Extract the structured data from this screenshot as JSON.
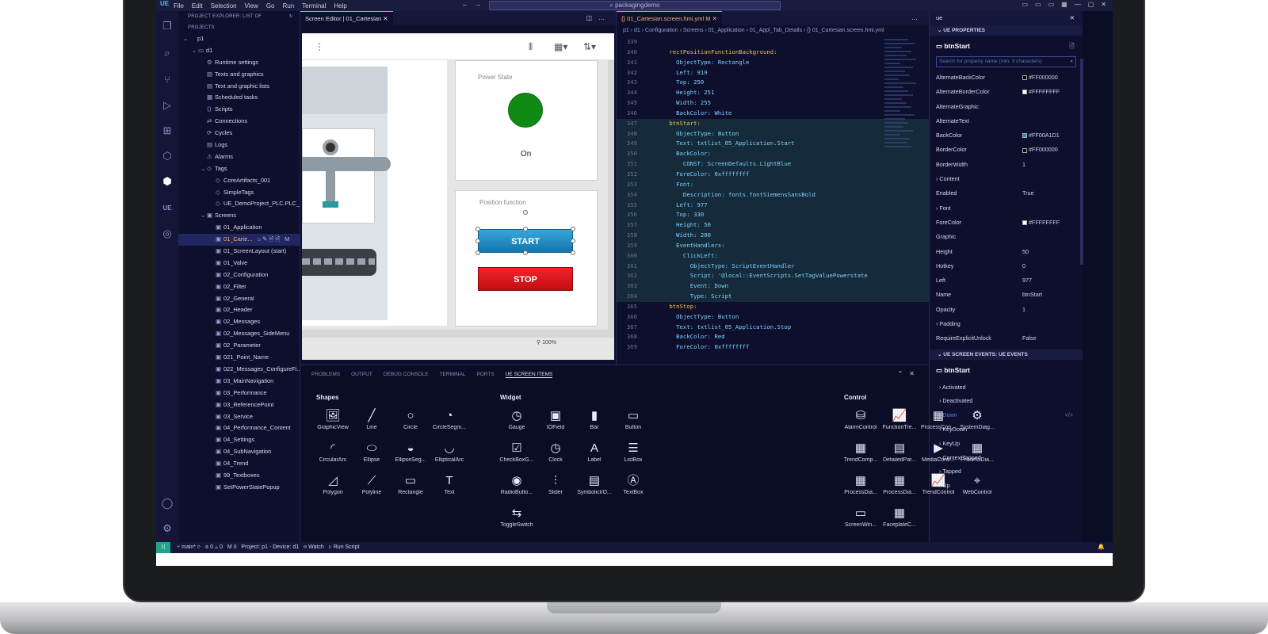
{
  "titlebar": {
    "logo": "UE",
    "menu": [
      "File",
      "Edit",
      "Selection",
      "View",
      "Go",
      "Run",
      "Terminal",
      "Help"
    ],
    "search": "packagingdemo"
  },
  "explorer": {
    "header": "PROJECT EXPLORER: LIST OF PROJECTS",
    "items": [
      {
        "label": "p1",
        "depth": 0,
        "tw": "⌄",
        "icon": ""
      },
      {
        "label": "d1",
        "depth": 1,
        "tw": "⌄",
        "icon": "▭"
      },
      {
        "label": "Runtime settings",
        "depth": 2,
        "tw": "",
        "icon": "⚙"
      },
      {
        "label": "Texts and graphics",
        "depth": 2,
        "tw": "",
        "icon": "▤"
      },
      {
        "label": "Text and graphic lists",
        "depth": 2,
        "tw": "",
        "icon": "▤"
      },
      {
        "label": "Scheduled tasks",
        "depth": 2,
        "tw": "",
        "icon": "▦"
      },
      {
        "label": "Scripts",
        "depth": 2,
        "tw": "",
        "icon": "⟨⟩"
      },
      {
        "label": "Connections",
        "depth": 2,
        "tw": "",
        "icon": "⇄"
      },
      {
        "label": "Cycles",
        "depth": 2,
        "tw": "",
        "icon": "⟳"
      },
      {
        "label": "Logs",
        "depth": 2,
        "tw": "",
        "icon": "▤"
      },
      {
        "label": "Alarms",
        "depth": 2,
        "tw": "",
        "icon": "⚠"
      },
      {
        "label": "Tags",
        "depth": 2,
        "tw": "⌄",
        "icon": "◇"
      },
      {
        "label": "CoreArtifacts_001",
        "depth": 3,
        "tw": "",
        "icon": "◇"
      },
      {
        "label": "SimpleTags",
        "depth": 3,
        "tw": "",
        "icon": "◇"
      },
      {
        "label": "UE_DemoProject_PLC.PLC_...",
        "depth": 3,
        "tw": "",
        "icon": "◇"
      },
      {
        "label": "Screens",
        "depth": 2,
        "tw": "⌄",
        "icon": "▣"
      },
      {
        "label": "01_Application",
        "depth": 3,
        "tw": "",
        "icon": "▣"
      },
      {
        "label": "01_Carte...",
        "depth": 3,
        "tw": "",
        "icon": "▣",
        "selected": true,
        "actions": "⌂✎🗎🗎 M"
      },
      {
        "label": "01_ScreenLayout (start)",
        "depth": 3,
        "tw": "",
        "icon": "▣"
      },
      {
        "label": "01_Valve",
        "depth": 3,
        "tw": "",
        "icon": "▣"
      },
      {
        "label": "02_Configuration",
        "depth": 3,
        "tw": "",
        "icon": "▣"
      },
      {
        "label": "02_Filter",
        "depth": 3,
        "tw": "",
        "icon": "▣"
      },
      {
        "label": "02_General",
        "depth": 3,
        "tw": "",
        "icon": "▣"
      },
      {
        "label": "02_Header",
        "depth": 3,
        "tw": "",
        "icon": "▣"
      },
      {
        "label": "02_Messages",
        "depth": 3,
        "tw": "",
        "icon": "▣"
      },
      {
        "label": "02_Messages_SideMenu",
        "depth": 3,
        "tw": "",
        "icon": "▣"
      },
      {
        "label": "02_Parameter",
        "depth": 3,
        "tw": "",
        "icon": "▣"
      },
      {
        "label": "021_Point_Name",
        "depth": 3,
        "tw": "",
        "icon": "▣"
      },
      {
        "label": "022_Messages_ConfigureFi...",
        "depth": 3,
        "tw": "",
        "icon": "▣"
      },
      {
        "label": "03_MainNavigation",
        "depth": 3,
        "tw": "",
        "icon": "▣"
      },
      {
        "label": "03_Performance",
        "depth": 3,
        "tw": "",
        "icon": "▣"
      },
      {
        "label": "03_ReferencePoint",
        "depth": 3,
        "tw": "",
        "icon": "▣"
      },
      {
        "label": "03_Service",
        "depth": 3,
        "tw": "",
        "icon": "▣"
      },
      {
        "label": "04_Performance_Content",
        "depth": 3,
        "tw": "",
        "icon": "▣"
      },
      {
        "label": "04_Settings",
        "depth": 3,
        "tw": "",
        "icon": "▣"
      },
      {
        "label": "04_SubNavigation",
        "depth": 3,
        "tw": "",
        "icon": "▣"
      },
      {
        "label": "04_Trend",
        "depth": 3,
        "tw": "",
        "icon": "▣"
      },
      {
        "label": "99_Textboxes",
        "depth": 3,
        "tw": "",
        "icon": "▣"
      },
      {
        "label": "SetPowerStatePopup",
        "depth": 3,
        "tw": "",
        "icon": "▣"
      }
    ]
  },
  "editor1": {
    "tab": "Screen Editor | 01_Cartesian",
    "panel1_title": "Power State",
    "power_on": "On",
    "panel2_title": "Position function",
    "start": "START",
    "stop": "STOP",
    "zoom": "100%"
  },
  "editor2": {
    "tab": "01_Cartesian.screen.hmi.yml M",
    "breadcrumb": "p1 › d1 › Configuration › Screens › 01_Application › 01_Appl_Tab_Details › {} 01_Cartesian.screen.hmi.yml",
    "lines": [
      {
        "n": "339",
        "t": "",
        "c": ""
      },
      {
        "n": "340",
        "t": "      rectPositionFunctionBackground:",
        "c": "k"
      },
      {
        "n": "341",
        "t": "        ObjectType: Rectangle",
        "c": ""
      },
      {
        "n": "342",
        "t": "        Left: 919",
        "c": ""
      },
      {
        "n": "343",
        "t": "        Top: 250",
        "c": ""
      },
      {
        "n": "344",
        "t": "        Height: 251",
        "c": ""
      },
      {
        "n": "345",
        "t": "        Width: 255",
        "c": ""
      },
      {
        "n": "346",
        "t": "        BackColor: White",
        "c": ""
      },
      {
        "n": "347",
        "t": "      btnStart:",
        "c": "k",
        "hl": true
      },
      {
        "n": "348",
        "t": "        ObjectType: Button",
        "c": "",
        "hl": true
      },
      {
        "n": "349",
        "t": "        Text: txtlist_05_Application.Start",
        "c": "",
        "hl": true
      },
      {
        "n": "350",
        "t": "        BackColor:",
        "c": "",
        "hl": true
      },
      {
        "n": "351",
        "t": "          CONST: ScreenDefaults.LightBlue",
        "c": "",
        "hl": true
      },
      {
        "n": "352",
        "t": "        ForeColor: 0xffffffff",
        "c": "",
        "hl": true
      },
      {
        "n": "353",
        "t": "        Font:",
        "c": "",
        "hl": true
      },
      {
        "n": "354",
        "t": "          Description: fonts.fontSiemensSansBold",
        "c": "",
        "hl": true
      },
      {
        "n": "355",
        "t": "        Left: 977",
        "c": "",
        "hl": true
      },
      {
        "n": "356",
        "t": "        Top: 330",
        "c": "",
        "hl": true
      },
      {
        "n": "357",
        "t": "        Height: 50",
        "c": "",
        "hl": true
      },
      {
        "n": "358",
        "t": "        Width: 200",
        "c": "",
        "hl": true
      },
      {
        "n": "359",
        "t": "        EventHandlers:",
        "c": "",
        "hl": true
      },
      {
        "n": "360",
        "t": "          ClickLeft:",
        "c": "",
        "hl": true
      },
      {
        "n": "361",
        "t": "            ObjectType: ScriptEventHandler",
        "c": "",
        "hl": true
      },
      {
        "n": "362",
        "t": "            Script: '@local::EventScripts.SetTagValuePowerstate",
        "c": "",
        "hl": true
      },
      {
        "n": "363",
        "t": "            Event: Down",
        "c": "",
        "hl": true
      },
      {
        "n": "364",
        "t": "            Type: Script",
        "c": "",
        "hl": true
      },
      {
        "n": "365",
        "t": "      btnStop:",
        "c": "k"
      },
      {
        "n": "366",
        "t": "        ObjectType: Button",
        "c": ""
      },
      {
        "n": "367",
        "t": "        Text: txtlist_05_Application.Stop",
        "c": ""
      },
      {
        "n": "368",
        "t": "        BackColor: Red",
        "c": ""
      },
      {
        "n": "369",
        "t": "        ForeColor: 0xffffffff",
        "c": ""
      }
    ]
  },
  "props": {
    "filter": "ue",
    "section": "UE PROPERTIES",
    "name": "btnStart",
    "search_placeholder": "Search for property name (min. 3 characters)",
    "rows": [
      {
        "n": "AlternateBackColor",
        "v": "#FF000000",
        "sw": "#000000"
      },
      {
        "n": "AlternateBorderColor",
        "v": "#FFFFFFFF",
        "sw": "#ffffff"
      },
      {
        "n": "AlternateGraphic",
        "v": ""
      },
      {
        "n": "AlternateText",
        "v": ""
      },
      {
        "n": "BackColor",
        "v": "#FF00A1D1",
        "sw": "#00a1d1"
      },
      {
        "n": "BorderColor",
        "v": "#FF000000",
        "sw": "#000000"
      },
      {
        "n": "BorderWidth",
        "v": "1"
      },
      {
        "n": "› Content",
        "v": ""
      },
      {
        "n": "Enabled",
        "v": "True"
      },
      {
        "n": "› Font",
        "v": ""
      },
      {
        "n": "ForeColor",
        "v": "#FFFFFFFF",
        "sw": "#ffffff"
      },
      {
        "n": "Graphic",
        "v": ""
      },
      {
        "n": "Height",
        "v": "50"
      },
      {
        "n": "Hotkey",
        "v": "0"
      },
      {
        "n": "Left",
        "v": "977"
      },
      {
        "n": "Name",
        "v": "btnStart"
      },
      {
        "n": "Opacity",
        "v": "1"
      },
      {
        "n": "› Padding",
        "v": ""
      },
      {
        "n": "RequireExplicitUnlock",
        "v": "False"
      }
    ],
    "events_section": "UE SCREEN EVENTS: UE EVENTS",
    "events_name": "btnStart",
    "events": [
      "Activated",
      "Deactivated",
      "Down",
      "KeyDown",
      "KeyUp",
      "ContextTapped",
      "Tapped",
      "Up"
    ]
  },
  "bottom": {
    "tabs": [
      "PROBLEMS",
      "OUTPUT",
      "DEBUG CONSOLE",
      "TERMINAL",
      "PORTS",
      "UE SCREEN ITEMS"
    ],
    "groups": {
      "shapes": "Shapes",
      "widget": "Widget",
      "control": "Control"
    },
    "shapes": [
      {
        "g": "🖼",
        "l": "GraphicView"
      },
      {
        "g": "╱",
        "l": "Line"
      },
      {
        "g": "○",
        "l": "Circle"
      },
      {
        "g": "◔",
        "l": "CircleSegm..."
      },
      {
        "g": "◜",
        "l": "CircularArc"
      },
      {
        "g": "⬭",
        "l": "Ellipse"
      },
      {
        "g": "◒",
        "l": "EllipseSeg..."
      },
      {
        "g": "◡",
        "l": "EllipticalArc"
      },
      {
        "g": "◿",
        "l": "Polygon"
      },
      {
        "g": "⟋",
        "l": "Polyline"
      },
      {
        "g": "▭",
        "l": "Rectangle"
      },
      {
        "g": "T",
        "l": "Text"
      }
    ],
    "widgets": [
      {
        "g": "◷",
        "l": "Gauge"
      },
      {
        "g": "▣",
        "l": "IOField"
      },
      {
        "g": "▮",
        "l": "Bar"
      },
      {
        "g": "▭",
        "l": "Button"
      },
      {
        "g": "☑",
        "l": "CheckBoxG..."
      },
      {
        "g": "◷",
        "l": "Clock"
      },
      {
        "g": "A",
        "l": "Label"
      },
      {
        "g": "☰",
        "l": "ListBox"
      },
      {
        "g": "◉",
        "l": "RadioButto..."
      },
      {
        "g": "⫶",
        "l": "Slider"
      },
      {
        "g": "▤",
        "l": "SymbolicI/O..."
      },
      {
        "g": "Ⓐ",
        "l": "TextBox"
      },
      {
        "g": "⇆",
        "l": "ToggleSwitch"
      }
    ],
    "controls": [
      {
        "g": "⛁",
        "l": "AlarmControl"
      },
      {
        "g": "📈",
        "l": "FunctionTre..."
      },
      {
        "g": "▦",
        "l": "ProcessCon..."
      },
      {
        "g": "⚙",
        "l": "SystemDiag..."
      },
      {
        "g": "▦",
        "l": "TrendComp..."
      },
      {
        "g": "▤",
        "l": "DetailedPar..."
      },
      {
        "g": "▶",
        "l": "MediaContr..."
      },
      {
        "g": "▦",
        "l": "ProcessDia..."
      },
      {
        "g": "▦",
        "l": "ProcessDia..."
      },
      {
        "g": "▦",
        "l": "ProcessDia..."
      },
      {
        "g": "📈",
        "l": "TrendControl"
      },
      {
        "g": "⌖",
        "l": "WebControl"
      },
      {
        "g": "▭",
        "l": "ScreenWin..."
      },
      {
        "g": "▦",
        "l": "FaceplateC..."
      }
    ]
  },
  "status": {
    "branch": "main*",
    "errors": "⊗ 0 ⚠ 0",
    "m": "M 0",
    "project": "Project: p1 - Device: d1",
    "watch": "Watch",
    "run": "Run Script"
  }
}
